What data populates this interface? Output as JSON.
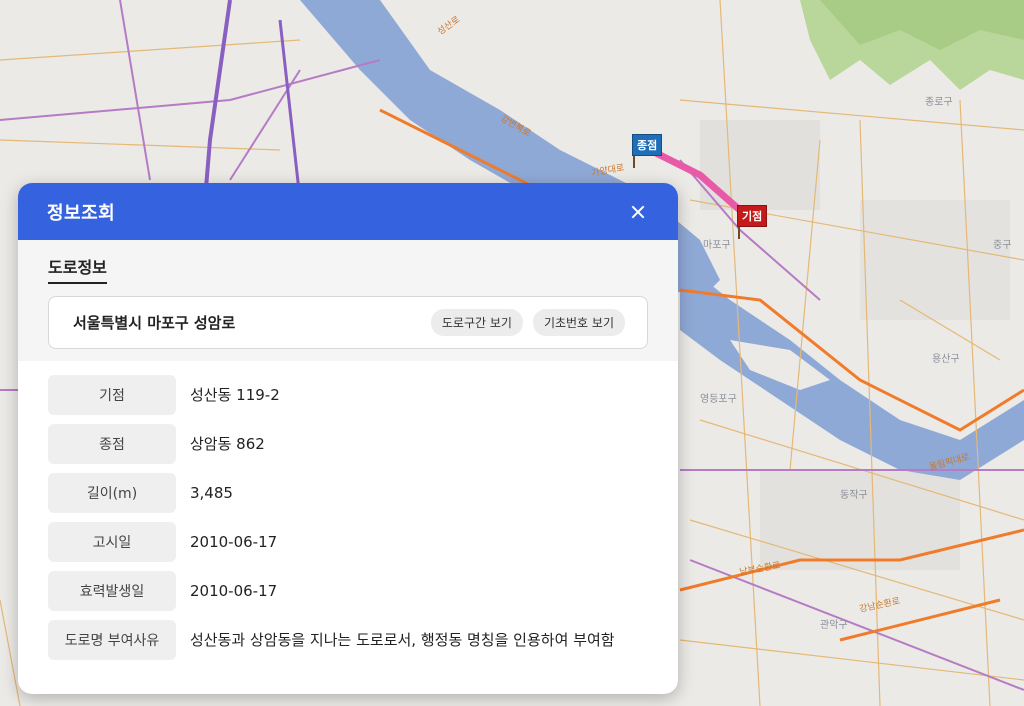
{
  "map": {
    "districts": [
      "종로구",
      "중구",
      "마포구",
      "용산구",
      "영등포구",
      "동작구",
      "관악구"
    ],
    "roads": [
      "강변북로",
      "올림픽대로",
      "남부순환로",
      "성산로",
      "가양대로",
      "강남순환로",
      "남부순환로"
    ],
    "markers": {
      "start": "기점",
      "end": "종점"
    },
    "colors": {
      "route": "#e85aa8",
      "river": "#8fa9d6",
      "highway": "#f07b2a"
    }
  },
  "panel": {
    "title": "정보조회",
    "tab_label": "도로정보",
    "road_name": "서울특별시 마포구 성암로",
    "buttons": {
      "section": "도로구간 보기",
      "basic_number": "기초번호 보기"
    },
    "rows": [
      {
        "key": "기점",
        "value": "성산동 119-2"
      },
      {
        "key": "종점",
        "value": "상암동 862"
      },
      {
        "key": "길이(m)",
        "value": "3,485"
      },
      {
        "key": "고시일",
        "value": "2010-06-17"
      },
      {
        "key": "효력발생일",
        "value": "2010-06-17"
      },
      {
        "key": "도로명 부여사유",
        "value": "성산동과 상암동을 지나는 도로로서, 행정동 명칭을 인용하여 부여함"
      }
    ]
  },
  "colors": {
    "header": "#3563e0"
  }
}
